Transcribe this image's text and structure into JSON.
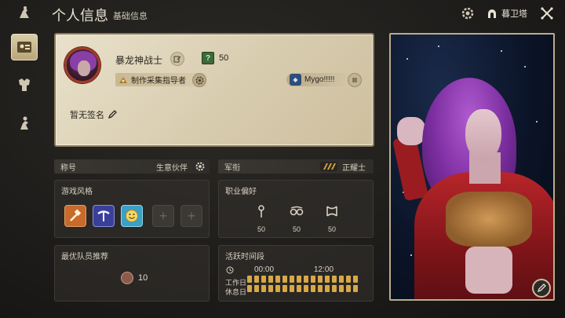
{
  "header": {
    "title": "个人信息",
    "subtitle": "基础信息",
    "location": "暮卫塔"
  },
  "sidebar": {
    "items": [
      {
        "icon": "id-card-icon",
        "active": true
      },
      {
        "icon": "armor-icon",
        "active": false
      },
      {
        "icon": "character-pose-icon",
        "active": false
      }
    ]
  },
  "profile": {
    "name": "暴龙神战士",
    "level": "50",
    "title_tag": "制作采集指导者",
    "free_company": "Mygo!!!!!",
    "signature": "暂无签名"
  },
  "nickname": {
    "label": "称号",
    "value": "生意伙伴"
  },
  "rank": {
    "label": "军衔",
    "value": "正耀士"
  },
  "play_style": {
    "title": "游戏风格",
    "icons": [
      "crafting-hammer-icon",
      "gathering-pick-icon",
      "smile-icon"
    ],
    "empty_slots": [
      "+",
      "+"
    ]
  },
  "job_pref": {
    "title": "职业偏好",
    "jobs": [
      {
        "icon": "tank-icon",
        "value": "50"
      },
      {
        "icon": "healer-icon",
        "value": "50"
      },
      {
        "icon": "dps-icon",
        "value": "50"
      }
    ]
  },
  "party": {
    "title": "最优队员推荐",
    "value": "10"
  },
  "active_time": {
    "title": "活跃时间段",
    "time_start": "00:00",
    "time_mid": "12:00",
    "weekday_label": "工作日",
    "holiday_label": "休息日"
  },
  "colors": {
    "accent_gold": "#d6a847",
    "card_bg": "#e3d9bf",
    "portrait_outfit": "#b8252a"
  }
}
